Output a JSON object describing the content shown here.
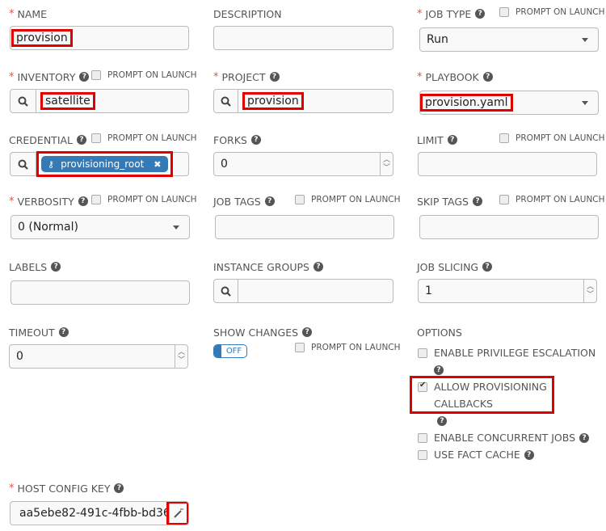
{
  "prompt_on_launch": "PROMPT ON LAUNCH",
  "name": {
    "label": "NAME",
    "value": "provision"
  },
  "description": {
    "label": "DESCRIPTION",
    "value": ""
  },
  "job_type": {
    "label": "JOB TYPE",
    "value": "Run"
  },
  "inventory": {
    "label": "INVENTORY",
    "value": "satellite"
  },
  "project": {
    "label": "PROJECT",
    "value": "provision"
  },
  "playbook": {
    "label": "PLAYBOOK",
    "value": "provision.yaml"
  },
  "credential": {
    "label": "CREDENTIAL",
    "chip": "provisioning_root"
  },
  "forks": {
    "label": "FORKS",
    "value": "0"
  },
  "limit": {
    "label": "LIMIT",
    "value": ""
  },
  "verbosity": {
    "label": "VERBOSITY",
    "value": "0 (Normal)"
  },
  "job_tags": {
    "label": "JOB TAGS",
    "value": ""
  },
  "skip_tags": {
    "label": "SKIP TAGS",
    "value": ""
  },
  "labels": {
    "label": "LABELS",
    "value": ""
  },
  "instance_groups": {
    "label": "INSTANCE GROUPS",
    "value": ""
  },
  "job_slicing": {
    "label": "JOB SLICING",
    "value": "1"
  },
  "timeout": {
    "label": "TIMEOUT",
    "value": "0"
  },
  "show_changes": {
    "label": "SHOW CHANGES",
    "toggle": "OFF"
  },
  "options": {
    "label": "OPTIONS",
    "items": [
      {
        "label": "ENABLE PRIVILEGE ESCALATION",
        "checked": false
      },
      {
        "label_line1": "ALLOW PROVISIONING",
        "label_line2": "CALLBACKS",
        "checked": true
      },
      {
        "label": "ENABLE CONCURRENT JOBS",
        "checked": false
      },
      {
        "label": "USE FACT CACHE",
        "checked": false
      }
    ]
  },
  "host_config_key": {
    "label": "HOST CONFIG KEY",
    "value": "aa5ebe82-491c-4fbb-bd36"
  },
  "colors": {
    "accent": "#337ab7",
    "required": "#d9534f",
    "highlight": "#e00000"
  }
}
